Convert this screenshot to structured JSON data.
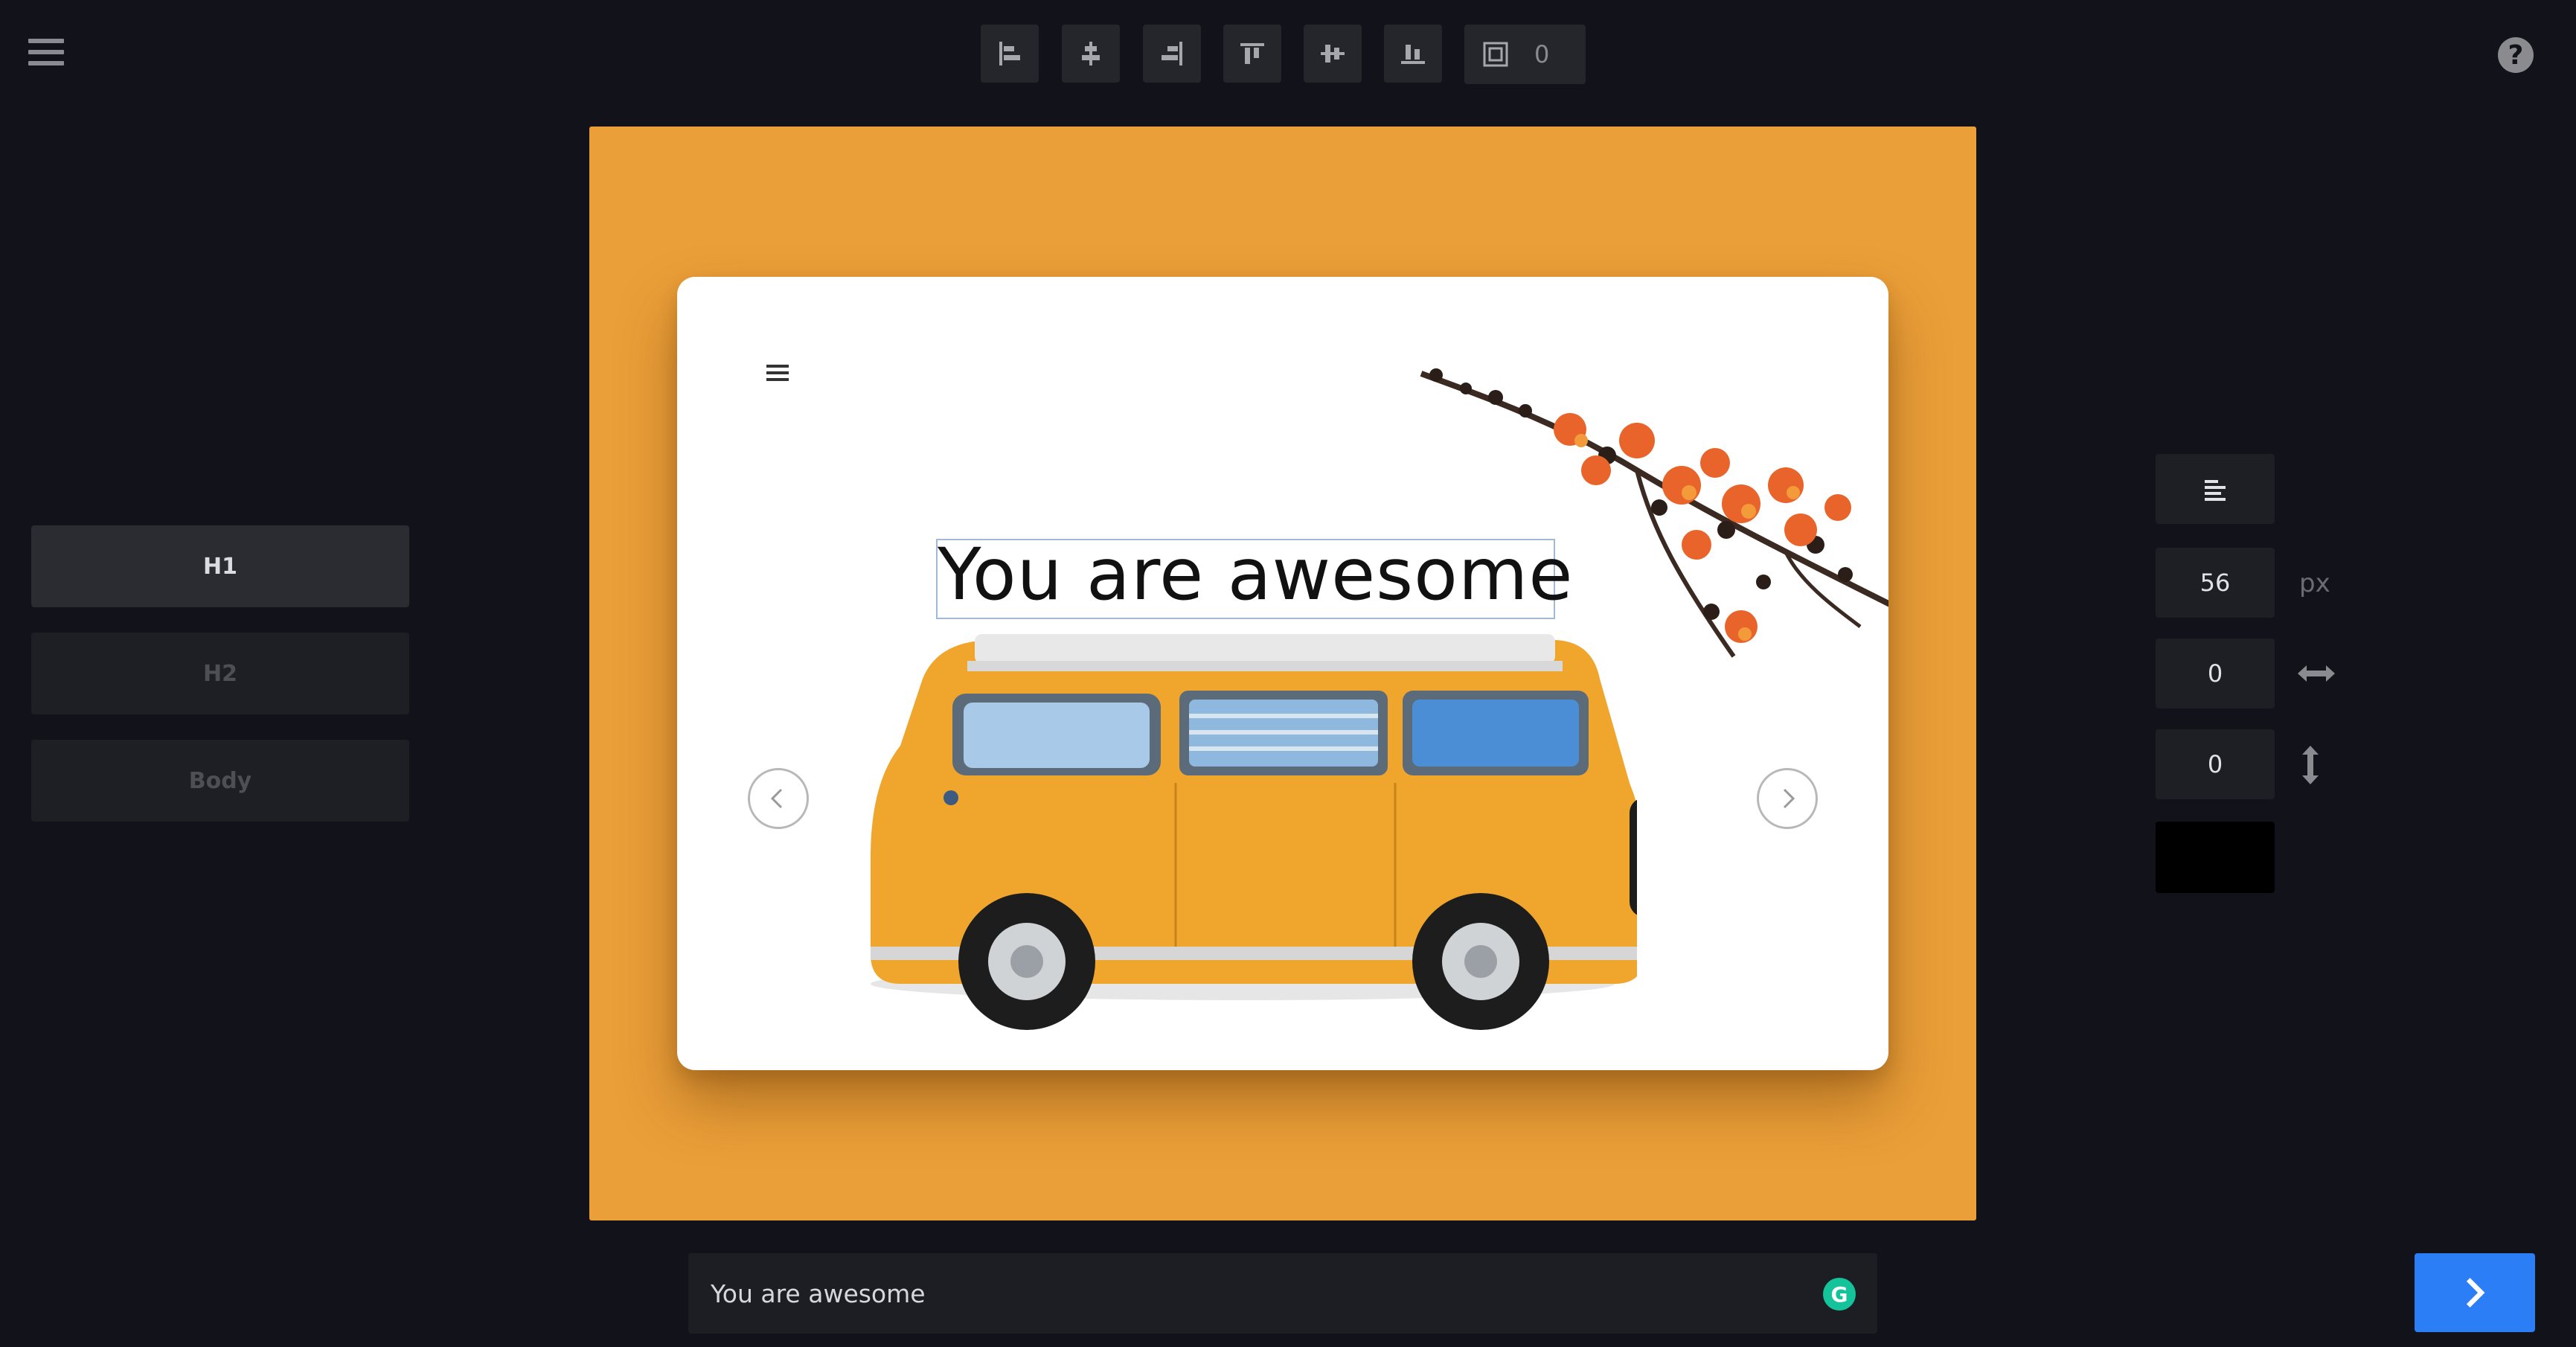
{
  "toolbar": {
    "buttons": [
      {
        "icon": "align-left-icon"
      },
      {
        "icon": "align-center-horizontal-icon"
      },
      {
        "icon": "align-right-icon"
      },
      {
        "icon": "align-top-icon"
      },
      {
        "icon": "align-middle-vertical-icon"
      },
      {
        "icon": "align-bottom-icon"
      }
    ],
    "padding_icon": "padding-icon",
    "padding_value": "0"
  },
  "help_icon": "help-icon",
  "text_styles": [
    {
      "label": "H1",
      "active": true
    },
    {
      "label": "H2",
      "active": false
    },
    {
      "label": "Body",
      "active": false
    }
  ],
  "card": {
    "headline": "You are awesome",
    "menu_icon": "menu-icon",
    "prev_icon": "chevron-left-icon",
    "next_icon": "chevron-right-icon",
    "background_color": "#eb9f38"
  },
  "properties": {
    "align_icon": "text-align-left-icon",
    "font_size": "56",
    "font_size_unit": "px",
    "letter_spacing": "0",
    "line_height": "0",
    "text_color": "#000000"
  },
  "text_input": {
    "value": "You are awesome"
  },
  "next_button_icon": "chevron-right-icon"
}
